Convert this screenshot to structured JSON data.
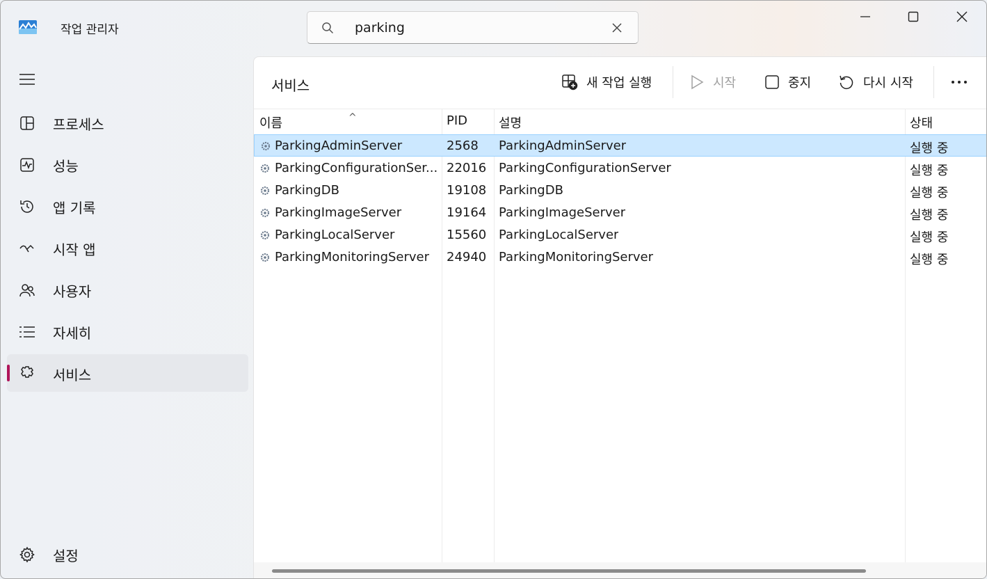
{
  "app": {
    "title": "작업 관리자",
    "accent": "#b0155a"
  },
  "search": {
    "value": "parking",
    "placeholder": ""
  },
  "sidebar": {
    "items": [
      {
        "label": "프로세스",
        "icon": "processes-icon"
      },
      {
        "label": "성능",
        "icon": "performance-icon"
      },
      {
        "label": "앱 기록",
        "icon": "history-icon"
      },
      {
        "label": "시작 앱",
        "icon": "startup-icon"
      },
      {
        "label": "사용자",
        "icon": "users-icon"
      },
      {
        "label": "자세히",
        "icon": "details-icon"
      },
      {
        "label": "서비스",
        "icon": "services-icon",
        "active": true
      }
    ],
    "settings_label": "설정"
  },
  "main": {
    "title": "서비스",
    "toolbar": {
      "run_new_task": "새 작업 실행",
      "start": "시작",
      "stop": "중지",
      "restart": "다시 시작"
    },
    "table": {
      "columns": [
        "이름",
        "PID",
        "설명",
        "상태"
      ],
      "rows": [
        {
          "name": "ParkingAdminServer",
          "pid": "2568",
          "desc": "ParkingAdminServer",
          "status": "실행 중"
        },
        {
          "name": "ParkingConfigurationSer...",
          "pid": "22016",
          "desc": "ParkingConfigurationServer",
          "status": "실행 중"
        },
        {
          "name": "ParkingDB",
          "pid": "19108",
          "desc": "ParkingDB",
          "status": "실행 중"
        },
        {
          "name": "ParkingImageServer",
          "pid": "19164",
          "desc": "ParkingImageServer",
          "status": "실행 중"
        },
        {
          "name": "ParkingLocalServer",
          "pid": "15560",
          "desc": "ParkingLocalServer",
          "status": "실행 중"
        },
        {
          "name": "ParkingMonitoringServer",
          "pid": "24940",
          "desc": "ParkingMonitoringServer",
          "status": "실행 중"
        }
      ]
    }
  }
}
